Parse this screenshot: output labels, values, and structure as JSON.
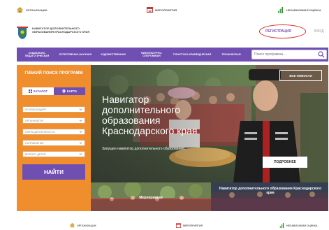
{
  "topbar": {
    "organizations": "Организации",
    "events_count": "10",
    "events": "Мероприятия",
    "independent_rating": "Независимая оценка"
  },
  "header": {
    "logo_text": "Навигатор дополнительного образования Краснодарского края",
    "register": "Регистрация",
    "login": "Вход"
  },
  "nav": {
    "items": [
      "Социально-педагогическая",
      "Естественно-научная",
      "Художественная",
      "Физкультурно-спортивная",
      "Туристско-краеведческая",
      "Техническая"
    ],
    "search_placeholder": "Поиск программы..."
  },
  "left_panel": {
    "title": "Гибкий поиск программ",
    "tab_catalog": "Каталог",
    "tab_map": "Карта",
    "filters": [
      "По КРАСНОДАРУ",
      "Организатор",
      "Сфера деятельности",
      "Направление",
      "Возраст детей"
    ],
    "find_button": "Найти"
  },
  "hero": {
    "title": "Навигатор дополнительного образования Краснодарского края",
    "subtitle": "Запущен навигатор дополнительного образования.",
    "all_news": "Все новости",
    "more": "Подробнее"
  },
  "strip": {
    "events_caption": "Мероприятия",
    "navigator_caption": "Навигатор дополнительного образования Краснодарского края"
  },
  "footer": {
    "organizations": "Организации",
    "events": "Мероприятия",
    "independent_rating": "Независимая оценка"
  },
  "colors": {
    "brand_purple": "#6f4fb1",
    "panel_orange": "#f08d2c",
    "highlight_red": "#e2261f"
  }
}
